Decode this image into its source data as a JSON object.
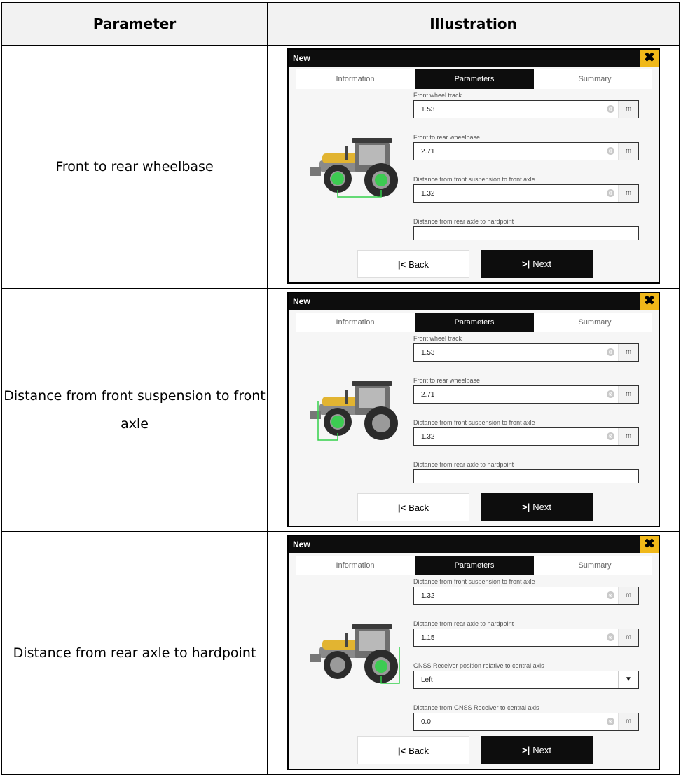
{
  "header": {
    "col1": "Parameter",
    "col2": "Illustration"
  },
  "ui": {
    "title": "New",
    "close": "✖",
    "tabs": [
      "Information",
      "Parameters",
      "Summary"
    ],
    "back_icon": "|<",
    "back_label": "Back",
    "next_icon": ">|",
    "next_label": "Next",
    "clear_icon": "⊗",
    "dropdown_icon": "▼"
  },
  "rows": [
    {
      "parameter": "Front to rear wheelbase",
      "highlight": "front-rear-wheelbase",
      "fields": [
        {
          "label": "Front wheel track",
          "value": "1.53",
          "unit": "m"
        },
        {
          "label": "Front to rear wheelbase",
          "value": "2.71",
          "unit": "m"
        },
        {
          "label": "Distance from front suspension to front axle",
          "value": "1.32",
          "unit": "m"
        },
        {
          "label": "Distance from rear axle to hardpoint",
          "value": "",
          "unit": ""
        }
      ]
    },
    {
      "parameter": "Distance from front suspension to front axle",
      "highlight": "front-suspension",
      "fields": [
        {
          "label": "Front wheel track",
          "value": "1.53",
          "unit": "m"
        },
        {
          "label": "Front to rear wheelbase",
          "value": "2.71",
          "unit": "m"
        },
        {
          "label": "Distance from front suspension to front axle",
          "value": "1.32",
          "unit": "m"
        },
        {
          "label": "Distance from rear axle to hardpoint",
          "value": "",
          "unit": ""
        }
      ]
    },
    {
      "parameter": "Distance from rear axle to hardpoint",
      "highlight": "rear-hardpoint",
      "fields": [
        {
          "label": "Distance from front suspension to front axle",
          "value": "1.32",
          "unit": "m"
        },
        {
          "label": "Distance from rear axle to hardpoint",
          "value": "1.15",
          "unit": "m"
        },
        {
          "label": "GNSS Receiver position relative to central axis",
          "value": "Left",
          "unit": "",
          "dropdown": true
        },
        {
          "label": "Distance from GNSS Receiver to central axis",
          "value": "0.0",
          "unit": "m"
        }
      ]
    }
  ],
  "colors": {
    "accent": "#f0b819",
    "dark": "#0d0d0d",
    "highlight": "#33d04a"
  }
}
